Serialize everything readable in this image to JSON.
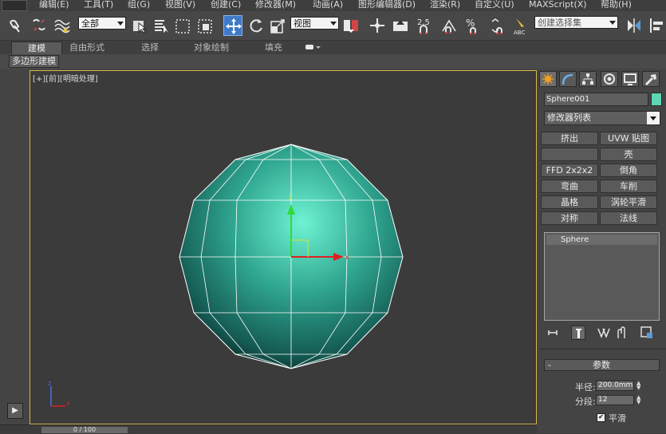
{
  "menubar": {
    "items": [
      "编辑(E)",
      "工具(T)",
      "组(G)",
      "视图(V)",
      "创建(C)",
      "修改器(M)",
      "动画(A)",
      "图形编辑器(D)",
      "渲染(R)",
      "自定义(U)",
      "MAXScript(X)",
      "帮助(H)"
    ]
  },
  "toolbar": {
    "selection_filter": "全部",
    "ref_coord": "视图",
    "snap_angle_label": "2.5",
    "named_selection_placeholder": "创建选择集"
  },
  "ribbon": {
    "tabs": [
      "建模",
      "自由形式",
      "选择",
      "对象绘制",
      "填充"
    ],
    "active_tab": "建模",
    "subpanel_button": "多边形建模"
  },
  "viewport": {
    "label_parts": [
      "[+]",
      "[前]",
      "[明暗处理]"
    ],
    "active_color": "#d8b54c",
    "axis_labels": {
      "x": "x",
      "y": "y",
      "z": "z"
    }
  },
  "timeline": {
    "frame_text": "0 / 100"
  },
  "command_panel": {
    "tab_icons": [
      "create-icon",
      "modify-icon",
      "hierarchy-icon",
      "motion-icon",
      "display-icon",
      "utilities-icon"
    ],
    "object_name": "Sphere001",
    "object_color": "#5fd6b3",
    "modifier_list": "修改器列表",
    "modifier_buttons": [
      [
        "挤出",
        "UVW 贴图"
      ],
      [
        "",
        "壳"
      ],
      [
        "FFD 2x2x2",
        "倒角"
      ],
      [
        "弯曲",
        "车削"
      ],
      [
        "晶格",
        "涡轮平滑"
      ],
      [
        "对称",
        "法线"
      ]
    ],
    "stack_items": [
      "Sphere"
    ],
    "stack_tool_icons": [
      "pin-stack-icon",
      "show-end-result-icon",
      "make-unique-icon",
      "remove-modifier-icon",
      "configure-sets-icon"
    ],
    "parameters": {
      "rollout_title": "参数",
      "rollout_toggle": "-",
      "radius_label": "半径:",
      "radius_value": "200.0mm",
      "segments_label": "分段:",
      "segments_value": "12",
      "smooth_label": "平滑",
      "smooth_checked": "✔"
    }
  }
}
